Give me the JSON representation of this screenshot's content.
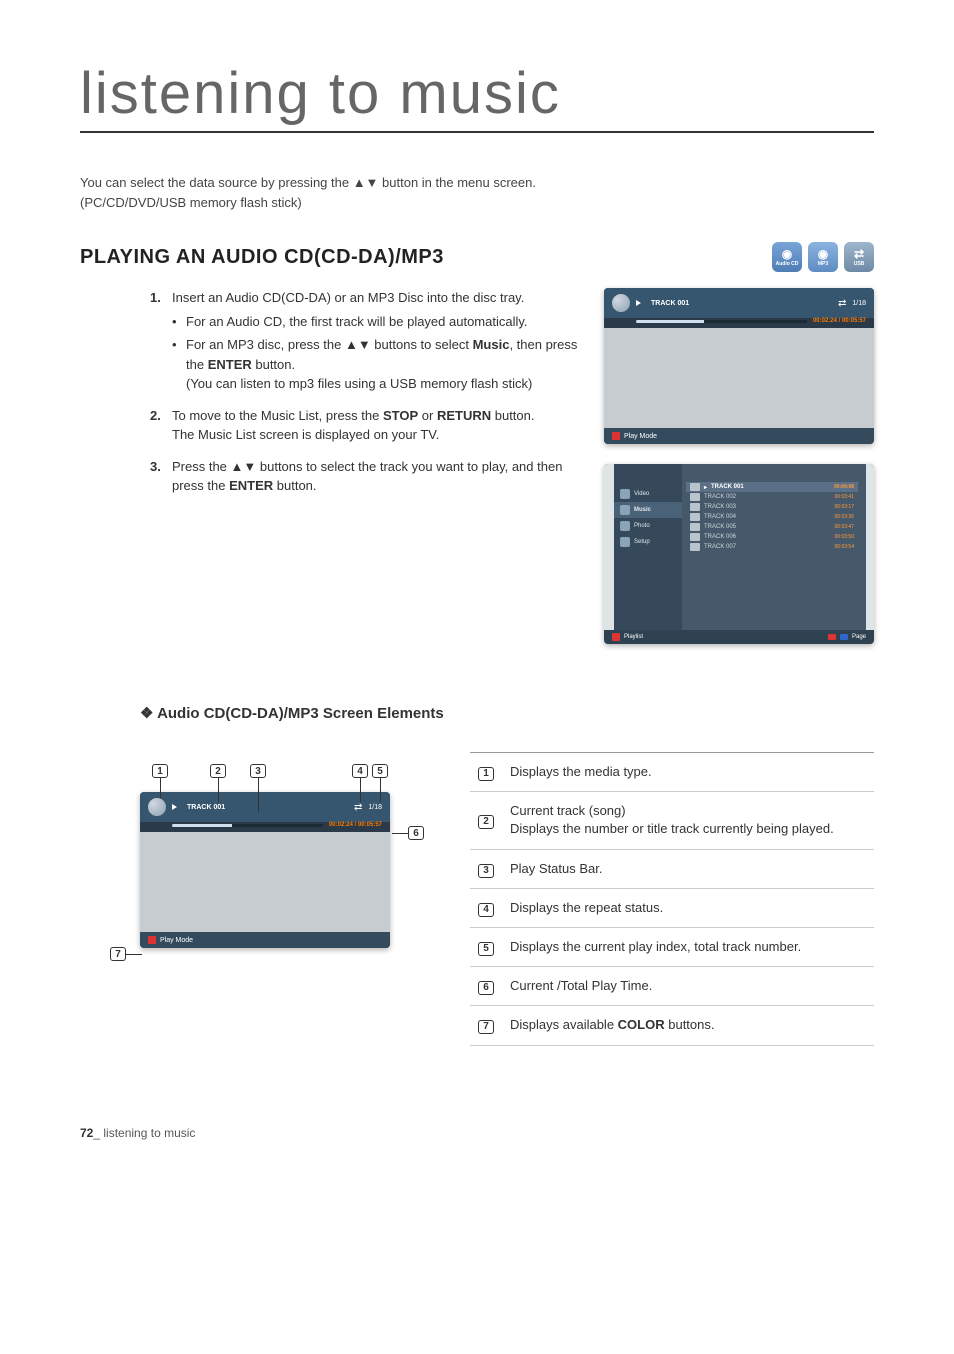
{
  "title": "listening to music",
  "intro_line1": "You can select the data source by pressing the ▲▼ button in the menu screen.",
  "intro_line2": "(PC/CD/DVD/USB memory flash stick)",
  "section_title": "PLAYING AN AUDIO CD(CD-DA)/MP3",
  "badges": {
    "audiocd": "Audio CD",
    "mp3": "MP3",
    "usb": "USB"
  },
  "steps": {
    "s1_text": "Insert an Audio CD(CD-DA) or an MP3 Disc into the disc tray.",
    "s1_b1": "For an Audio CD, the first track will be played automatically.",
    "s1_b2_a": "For an MP3 disc, press the ",
    "s1_b2_arrows": "▲▼",
    "s1_b2_b": " buttons to select ",
    "s1_b2_music": "Music",
    "s1_b2_c": ", then press the ",
    "s1_b2_enter": "ENTER",
    "s1_b2_d": " button.",
    "s1_b2_sub": "(You can listen to mp3 files using a USB memory flash stick)",
    "s2_a": "To move to the Music List, press the ",
    "s2_stop": "STOP",
    "s2_or": " or ",
    "s2_return": "RETURN",
    "s2_b": " button.",
    "s2_sub": "The Music List screen is displayed on your TV.",
    "s3_a": "Press the ",
    "s3_arrows": "▲▼",
    "s3_b": " buttons to select the track you want to play, and then press the ",
    "s3_enter": "ENTER",
    "s3_c": " button."
  },
  "playback": {
    "track": "TRACK 001",
    "index": "1/18",
    "time": "00:02:24 / 00:05:57",
    "playmode": "Play Mode"
  },
  "menu": {
    "video": "Video",
    "music": "Music",
    "photo": "Photo",
    "setup": "Setup",
    "tracks": [
      {
        "name": "TRACK 001",
        "dur": "00:04:08",
        "sel": true
      },
      {
        "name": "TRACK 002",
        "dur": "00:03:41",
        "sel": false
      },
      {
        "name": "TRACK 003",
        "dur": "00:03:17",
        "sel": false
      },
      {
        "name": "TRACK 004",
        "dur": "00:03:36",
        "sel": false
      },
      {
        "name": "TRACK 005",
        "dur": "00:03:47",
        "sel": false
      },
      {
        "name": "TRACK 006",
        "dur": "00:03:50",
        "sel": false
      },
      {
        "name": "TRACK 007",
        "dur": "00:03:54",
        "sel": false
      }
    ],
    "playlist": "Playlist",
    "page": "Page"
  },
  "sub_title": "Audio CD(CD-DA)/MP3 Screen Elements",
  "elements": [
    {
      "n": "1",
      "desc": "Displays the media type."
    },
    {
      "n": "2",
      "desc": "Current track (song)\nDisplays the number or title track currently being played."
    },
    {
      "n": "3",
      "desc": "Play Status Bar."
    },
    {
      "n": "4",
      "desc": "Displays the repeat status."
    },
    {
      "n": "5",
      "desc": "Displays the current play index, total track number."
    },
    {
      "n": "6",
      "desc": "Current /Total Play Time."
    },
    {
      "n": "7",
      "desc_a": "Displays available ",
      "desc_bold": "COLOR",
      "desc_b": " buttons."
    }
  ],
  "footer": {
    "page_num": "72",
    "sep": "_ ",
    "label": "listening to music"
  }
}
